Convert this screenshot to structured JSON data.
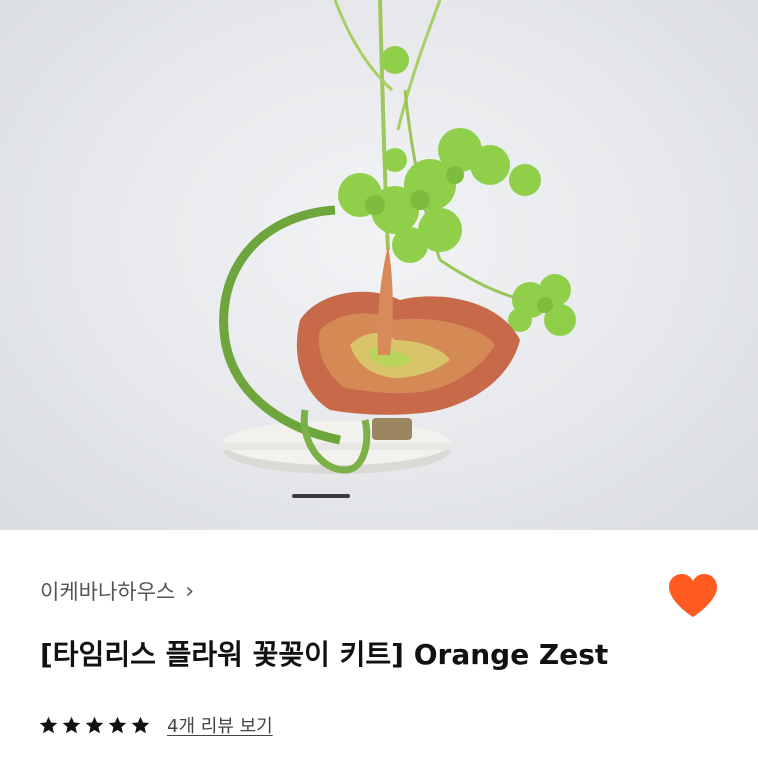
{
  "product_image": {
    "alt": "",
    "carousel_indicator": "active"
  },
  "product": {
    "brand": "이케바나하우스",
    "brand_chevron": "›",
    "title": "[타임리스 플라워 꽃꽂이 키트] Orange Zest",
    "favorite": true,
    "favorite_color": "#FF5A1F",
    "rating": 5,
    "rating_max": 5,
    "review_link": "4개 리뷰 보기"
  },
  "icons": {
    "brand_chevron": "chevron-right-icon",
    "favorite": "heart-icon",
    "star": "star-icon"
  }
}
